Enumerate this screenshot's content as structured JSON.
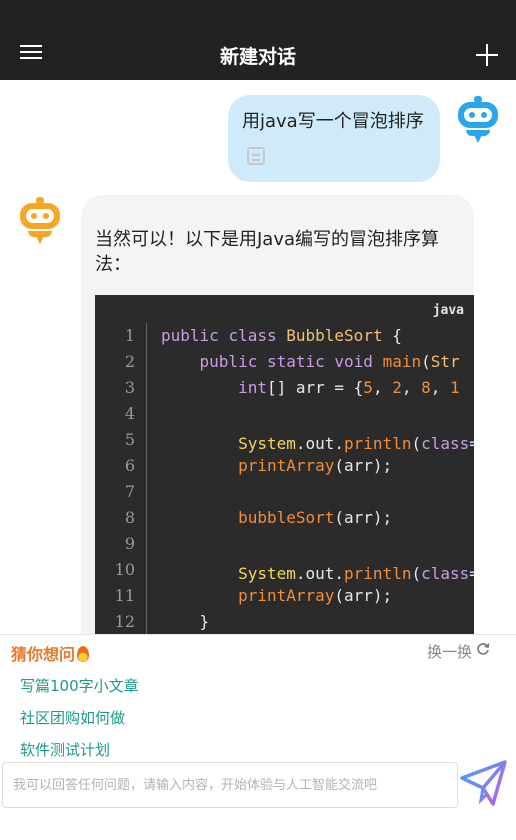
{
  "header": {
    "title": "新建对话",
    "menu_icon": "menu-icon",
    "new_icon": "plus-icon"
  },
  "conversation": {
    "user_message": "用java写一个冒泡排序",
    "bot_intro": "当然可以！以下是用Java编写的冒泡排序算法：",
    "code": {
      "language": "java",
      "lines": [
        {
          "n": "1",
          "t": "public class BubbleSort {"
        },
        {
          "n": "2",
          "t": "    public static void main(Str"
        },
        {
          "n": "3",
          "t": "        int[] arr = {5, 2, 8, 1"
        },
        {
          "n": "4",
          "t": ""
        },
        {
          "n": "5",
          "t": "        System.out.println(\"排序"
        },
        {
          "n": "6",
          "t": "        printArray(arr);"
        },
        {
          "n": "7",
          "t": ""
        },
        {
          "n": "8",
          "t": "        bubbleSort(arr);"
        },
        {
          "n": "9",
          "t": ""
        },
        {
          "n": "10",
          "t": "        System.out.println(\"排序"
        },
        {
          "n": "11",
          "t": "        printArray(arr);"
        },
        {
          "n": "12",
          "t": "    }"
        }
      ]
    }
  },
  "suggestions": {
    "title": "猜你想问",
    "refresh_label": "换一换",
    "items": [
      "写篇100字小文章",
      "社区团购如何做",
      "软件测试计划"
    ]
  },
  "input": {
    "placeholder": "我可以回答任何问题，请输入内容，开始体验与人工智能交流吧"
  },
  "colors": {
    "header_bg": "#222222",
    "user_bubble": "#cfebfb",
    "bot_bubble": "#f4f4f4",
    "accent_orange": "#e8782c",
    "suggest_teal": "#1e9a8a"
  }
}
